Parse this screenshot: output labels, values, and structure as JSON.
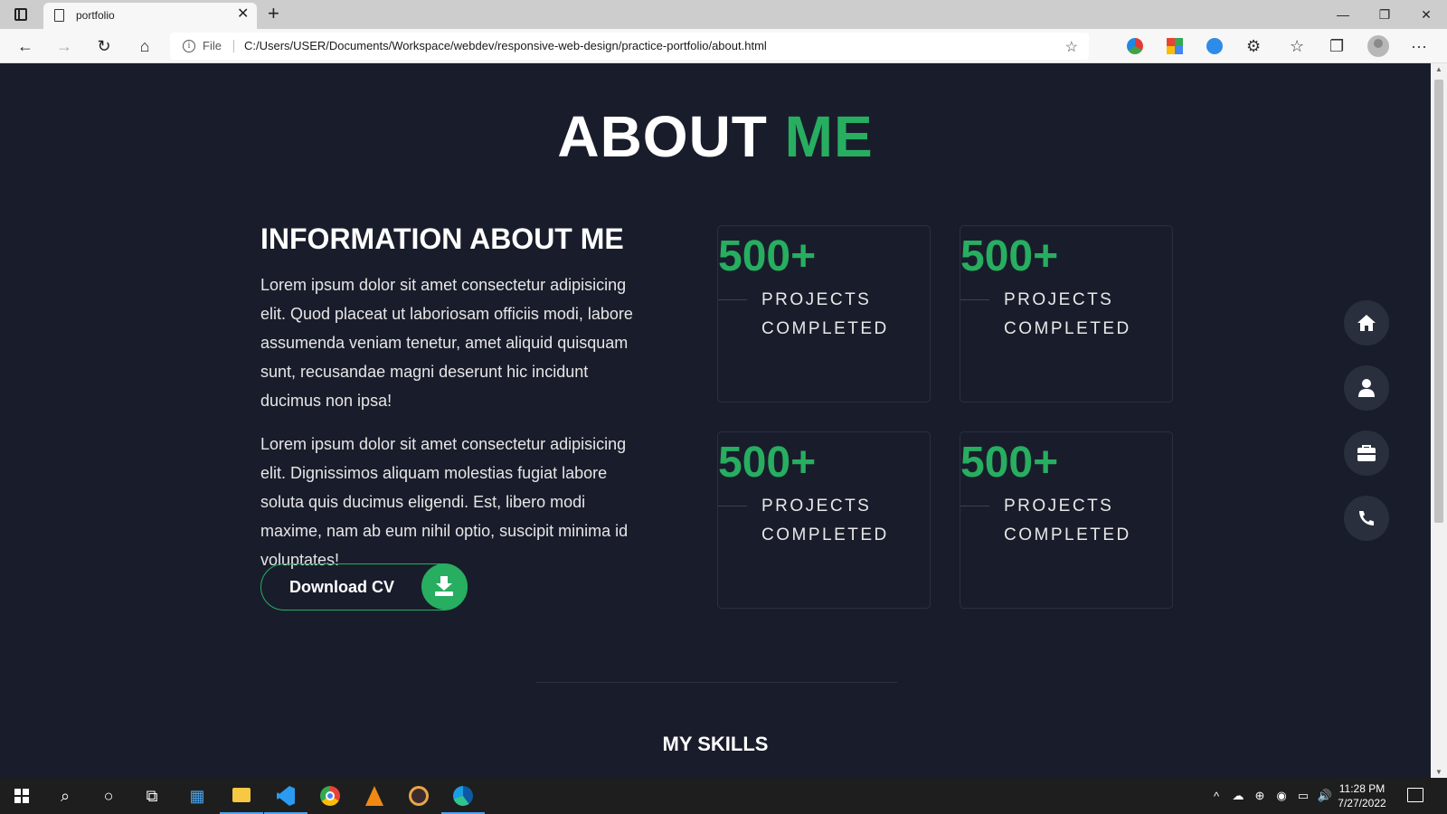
{
  "browser": {
    "tab_title": "portfolio",
    "tab_close": "✕",
    "new_tab": "+",
    "window_controls": [
      "—",
      "❐",
      "✕"
    ],
    "address_prefix": "File",
    "url": "C:/Users/USER/Documents/Workspace/webdev/responsive-web-design/practice-portfolio/about.html",
    "nav": {
      "back": "←",
      "forward": "→",
      "reload": "↻",
      "home": "⌂"
    },
    "toolbar_glyphs": {
      "favorites_add": "☆",
      "extensions": "⚙",
      "favorites": "☆",
      "collections": "❐",
      "menu": "···"
    }
  },
  "page": {
    "heading_main": "ABOUT",
    "heading_accent": "ME",
    "info_title": "INFORMATION ABOUT ME",
    "paragraph_1": "Lorem ipsum dolor sit amet consectetur adipisicing elit. Quod placeat ut laboriosam officiis modi, labore assumenda veniam tenetur, amet aliquid quisquam sunt, recusandae magni deserunt hic incidunt ducimus non ipsa!",
    "paragraph_2": "Lorem ipsum dolor sit amet consectetur adipisicing elit. Dignissimos aliquam molestias fugiat labore soluta quis ducimus eligendi. Est, libero modi maxime, nam ab eum nihil optio, suscipit minima id voluptates!",
    "download_button": "Download CV",
    "stats": [
      {
        "number": "500+",
        "label": "PROJECTS COMPLETED"
      },
      {
        "number": "500+",
        "label": "PROJECTS COMPLETED"
      },
      {
        "number": "500+",
        "label": "PROJECTS COMPLETED"
      },
      {
        "number": "500+",
        "label": "PROJECTS COMPLETED"
      }
    ],
    "skills_title": "MY SKILLS",
    "side_nav": [
      "home-icon",
      "user-icon",
      "briefcase-icon",
      "phone-icon"
    ]
  },
  "colors": {
    "background": "#191d2b",
    "accent": "#27ae60",
    "card_border": "#2a2f42",
    "side_button": "#2a2f3e"
  },
  "taskbar": {
    "apps": [
      "start",
      "search",
      "cortana",
      "task-view",
      "store",
      "file-explorer",
      "vscode",
      "chrome",
      "vlc",
      "music-app",
      "edge"
    ],
    "glyphs": {
      "search": "⌕",
      "cortana": "○",
      "task_view": "⧉",
      "store": "▦"
    },
    "tray_glyphs": [
      "^",
      "☁",
      "⊕",
      "◉",
      "▭",
      "🔊"
    ],
    "time": "11:28 PM",
    "date": "7/27/2022"
  }
}
